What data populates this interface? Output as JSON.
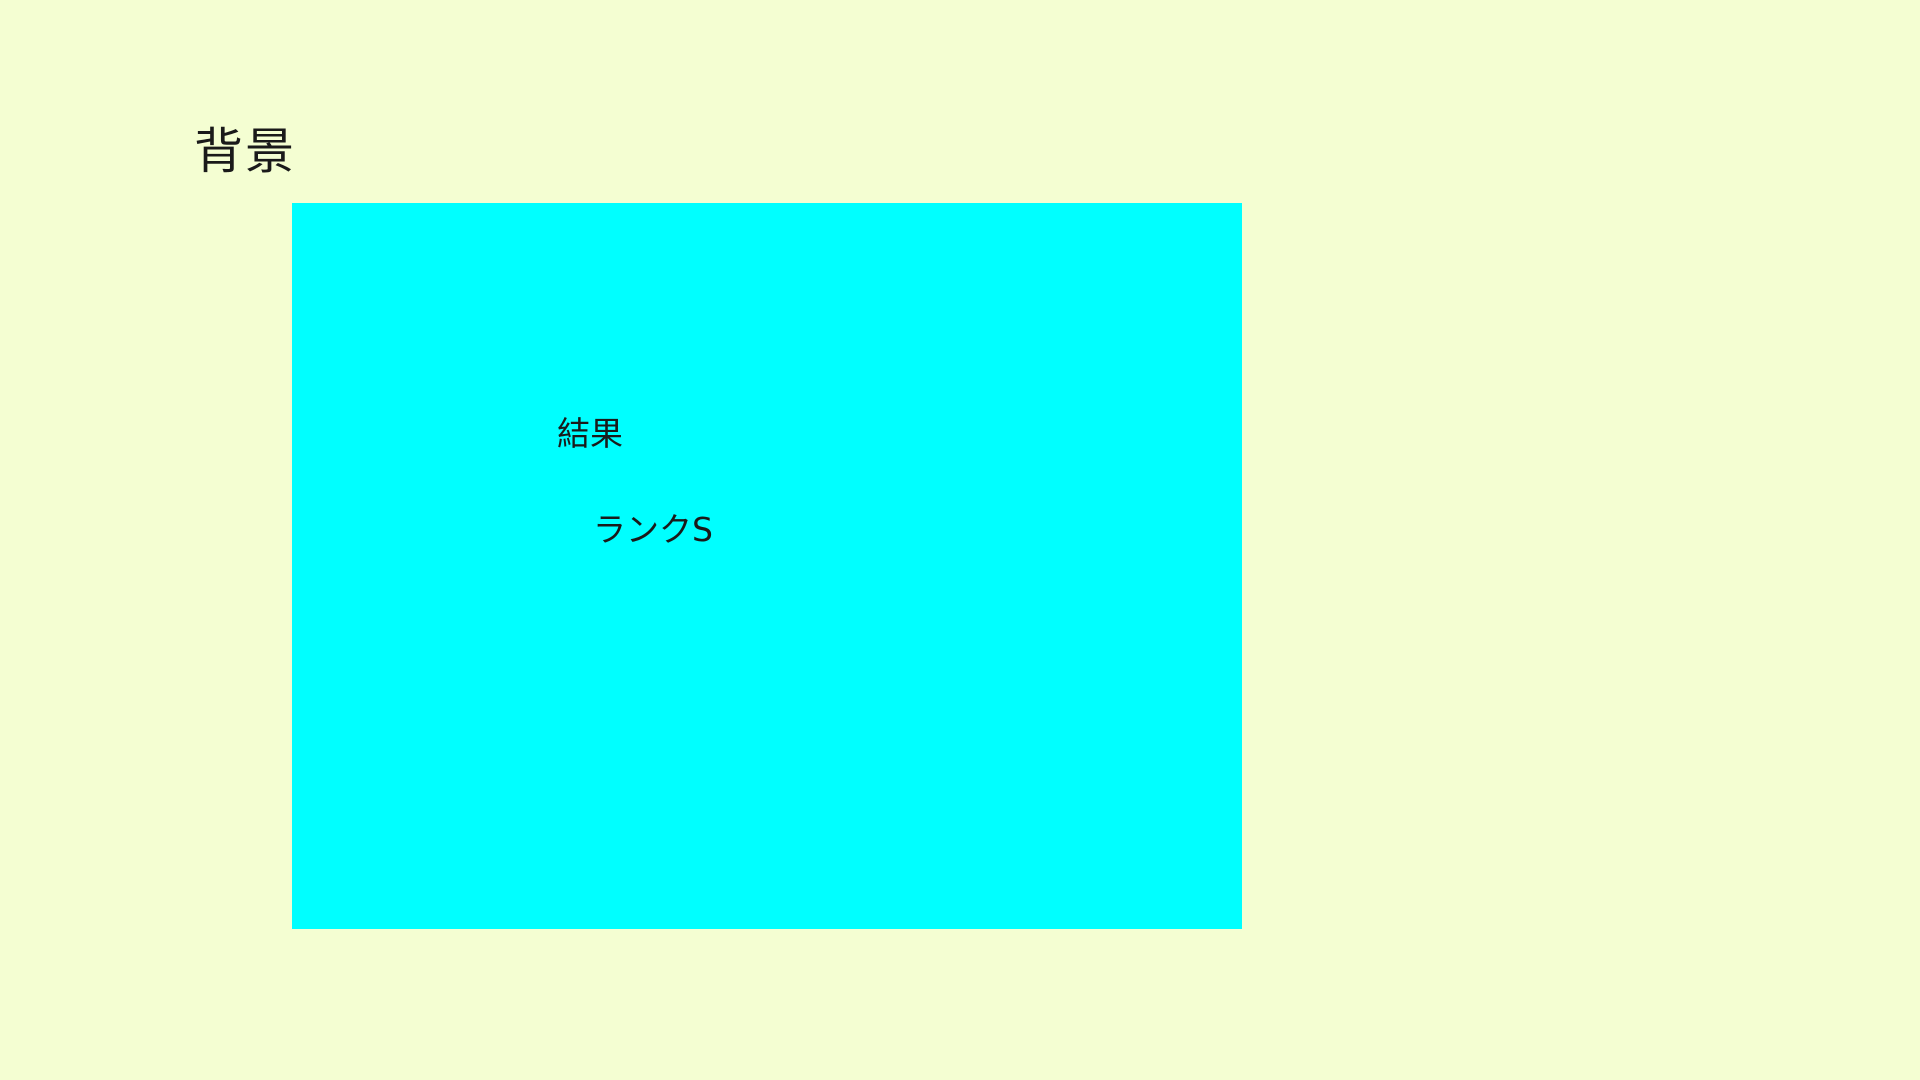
{
  "colors": {
    "background": "#F4FED2",
    "panel": "#00FFFF",
    "text": "#1a1a1a"
  },
  "background_label": "背景",
  "result": {
    "heading": "結果",
    "rank": "ランクS"
  }
}
